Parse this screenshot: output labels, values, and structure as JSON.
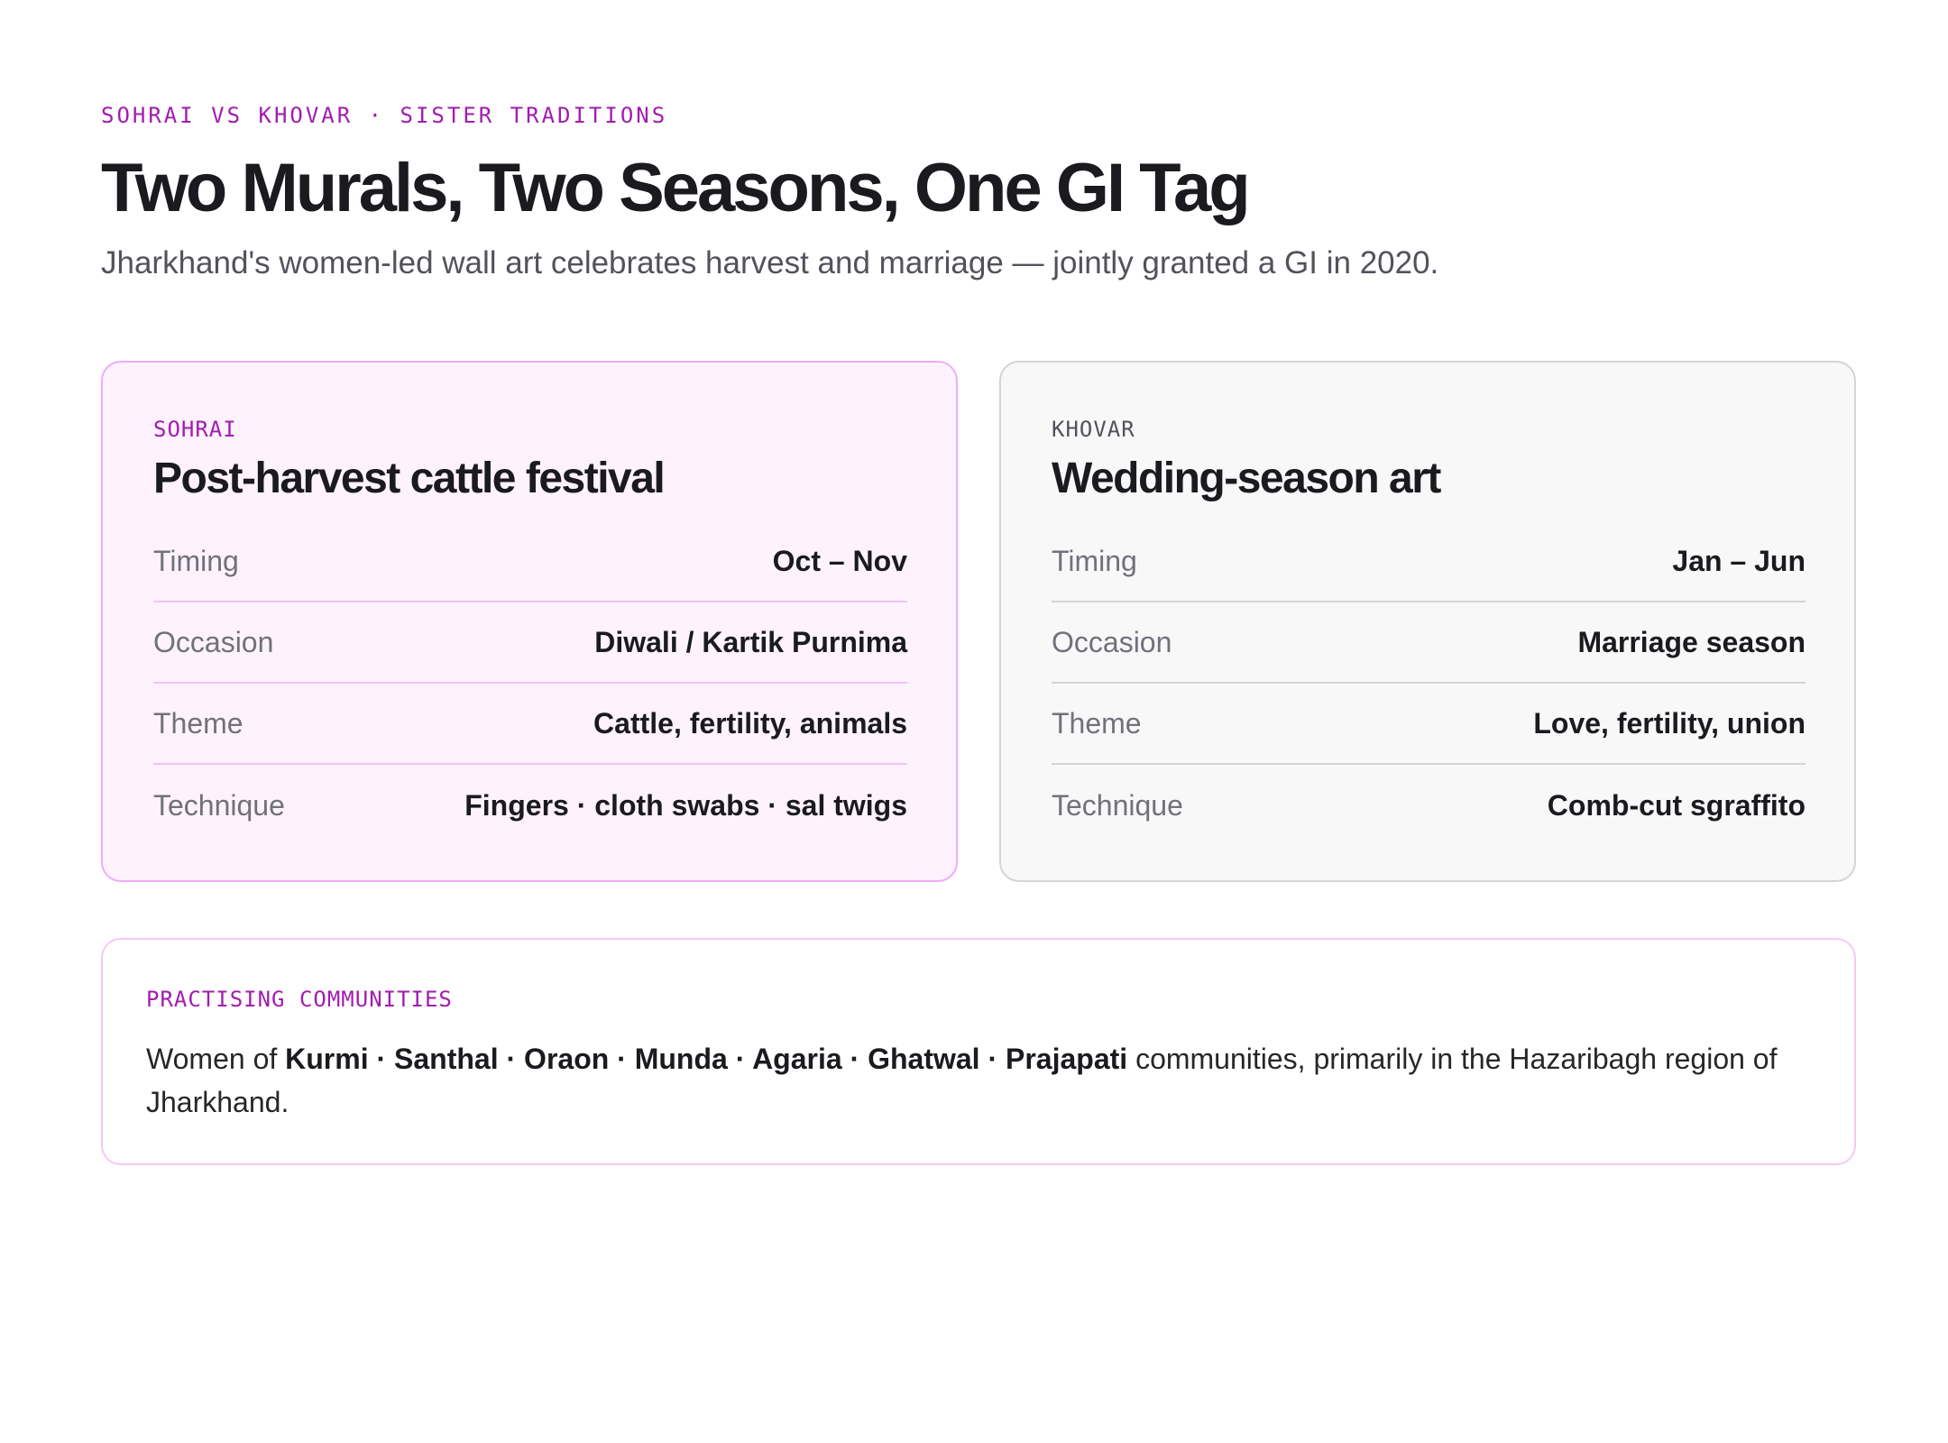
{
  "header": {
    "eyebrow": "SOHRAI VS KHOVAR · SISTER TRADITIONS",
    "title": "Two Murals, Two Seasons, One GI Tag",
    "subtitle": "Jharkhand's women-led wall art celebrates harvest and marriage — jointly granted a GI in 2020."
  },
  "cards": [
    {
      "label": "SOHRAI",
      "title": "Post-harvest cattle festival",
      "rows": [
        {
          "key": "Timing",
          "value": "Oct – Nov"
        },
        {
          "key": "Occasion",
          "value": "Diwali / Kartik Purnima"
        },
        {
          "key": "Theme",
          "value": "Cattle, fertility, animals"
        },
        {
          "key": "Technique",
          "value": "Fingers · cloth swabs · sal twigs"
        }
      ]
    },
    {
      "label": "KHOVAR",
      "title": "Wedding-season art",
      "rows": [
        {
          "key": "Timing",
          "value": "Jan – Jun"
        },
        {
          "key": "Occasion",
          "value": "Marriage season"
        },
        {
          "key": "Theme",
          "value": "Love, fertility, union"
        },
        {
          "key": "Technique",
          "value": "Comb-cut sgraffito"
        }
      ]
    }
  ],
  "communities": {
    "label": "PRACTISING COMMUNITIES",
    "prefix": "Women of ",
    "names": "Kurmi · Santhal · Oraon · Munda · Agaria · Ghatwal · Prajapati",
    "suffix": " communities, primarily in the Hazaribagh region of Jharkhand."
  },
  "colors": {
    "accent": "#a21caf",
    "sohrai_bg": "#fdf2fd",
    "sohrai_border": "#f0abfc",
    "khovar_bg": "#f8f8f9",
    "khovar_border": "#d4d4d8",
    "text": "#1a1a1f",
    "muted": "#71717a"
  }
}
